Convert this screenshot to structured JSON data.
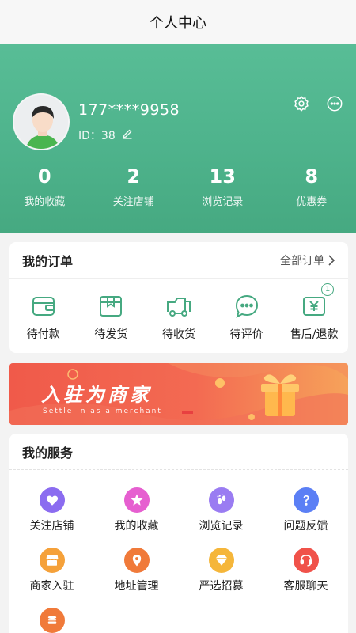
{
  "header": {
    "title": "个人中心"
  },
  "profile": {
    "phone": "177****9958",
    "id_label": "ID：38",
    "stats": [
      {
        "value": "0",
        "label": "我的收藏"
      },
      {
        "value": "2",
        "label": "关注店铺"
      },
      {
        "value": "13",
        "label": "浏览记录"
      },
      {
        "value": "8",
        "label": "优惠券"
      }
    ]
  },
  "orders": {
    "title": "我的订单",
    "all_label": "全部订单",
    "items": [
      {
        "label": "待付款",
        "icon": "wallet-icon"
      },
      {
        "label": "待发货",
        "icon": "package-icon"
      },
      {
        "label": "待收货",
        "icon": "truck-icon"
      },
      {
        "label": "待评价",
        "icon": "chat-icon"
      },
      {
        "label": "售后/退款",
        "icon": "refund-icon",
        "badge": "1"
      }
    ]
  },
  "banner": {
    "title": "入驻为商家",
    "subtitle": "Settle in as a merchant"
  },
  "services": {
    "title": "我的服务",
    "items": [
      {
        "label": "关注店铺",
        "icon": "heart-icon",
        "color": "#8b6cf0"
      },
      {
        "label": "我的收藏",
        "icon": "star-icon",
        "color": "#e65fd0"
      },
      {
        "label": "浏览记录",
        "icon": "footprint-icon",
        "color": "#9a7cf2"
      },
      {
        "label": "问题反馈",
        "icon": "question-icon",
        "color": "#5b7ff5"
      },
      {
        "label": "商家入驻",
        "icon": "store-icon",
        "color": "#f5a13a"
      },
      {
        "label": "地址管理",
        "icon": "location-icon",
        "color": "#f07a3a"
      },
      {
        "label": "严选招募",
        "icon": "diamond-icon",
        "color": "#f5b63a"
      },
      {
        "label": "客服聊天",
        "icon": "headset-icon",
        "color": "#f0524a"
      },
      {
        "label": "",
        "icon": "coins-icon",
        "color": "#f07a3a"
      }
    ]
  },
  "colors": {
    "primary": "#46a981",
    "banner": "#f05a4a"
  }
}
